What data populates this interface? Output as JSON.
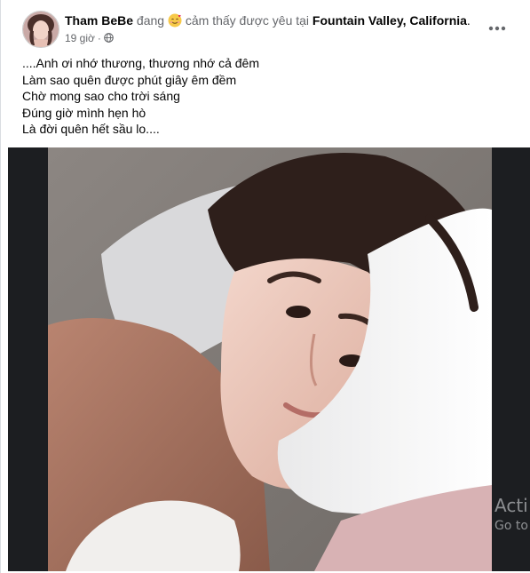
{
  "post": {
    "author": "Tham BeBe",
    "status_verb": "đang",
    "feeling_emoji": "smiling-face-with-hearts-icon",
    "feeling_text": "cảm thấy được yêu tại",
    "location": "Fountain Valley, California",
    "location_suffix": ".",
    "time": "19 giờ",
    "separator": "·",
    "audience_icon": "globe-icon",
    "more_icon": "more-options-icon",
    "text_lines": [
      "....Anh ơi nhớ thương, thương nhớ cả đêm",
      "Làm sao quên được phút giây êm đềm",
      "Chờ mong sao cho trời sáng",
      "Đúng giờ mình hẹn hò",
      "Là đời quên hết sầu lo...."
    ]
  },
  "overlay": {
    "activate_line1": "Acti",
    "activate_line2": "Go to"
  },
  "colors": {
    "text_primary": "#050505",
    "text_secondary": "#65676b",
    "media_background": "#1c1e21",
    "card_background": "#ffffff"
  }
}
